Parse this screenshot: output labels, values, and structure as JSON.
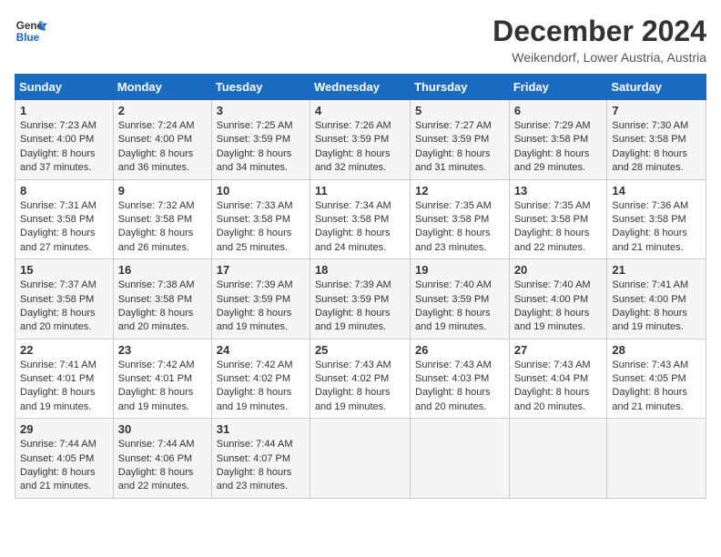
{
  "header": {
    "logo_line1": "General",
    "logo_line2": "Blue",
    "month_title": "December 2024",
    "location": "Weikendorf, Lower Austria, Austria"
  },
  "weekdays": [
    "Sunday",
    "Monday",
    "Tuesday",
    "Wednesday",
    "Thursday",
    "Friday",
    "Saturday"
  ],
  "weeks": [
    [
      {
        "day": "1",
        "sunrise": "7:23 AM",
        "sunset": "4:00 PM",
        "daylight": "8 hours and 37 minutes."
      },
      {
        "day": "2",
        "sunrise": "7:24 AM",
        "sunset": "4:00 PM",
        "daylight": "8 hours and 36 minutes."
      },
      {
        "day": "3",
        "sunrise": "7:25 AM",
        "sunset": "3:59 PM",
        "daylight": "8 hours and 34 minutes."
      },
      {
        "day": "4",
        "sunrise": "7:26 AM",
        "sunset": "3:59 PM",
        "daylight": "8 hours and 32 minutes."
      },
      {
        "day": "5",
        "sunrise": "7:27 AM",
        "sunset": "3:59 PM",
        "daylight": "8 hours and 31 minutes."
      },
      {
        "day": "6",
        "sunrise": "7:29 AM",
        "sunset": "3:58 PM",
        "daylight": "8 hours and 29 minutes."
      },
      {
        "day": "7",
        "sunrise": "7:30 AM",
        "sunset": "3:58 PM",
        "daylight": "8 hours and 28 minutes."
      }
    ],
    [
      {
        "day": "8",
        "sunrise": "7:31 AM",
        "sunset": "3:58 PM",
        "daylight": "8 hours and 27 minutes."
      },
      {
        "day": "9",
        "sunrise": "7:32 AM",
        "sunset": "3:58 PM",
        "daylight": "8 hours and 26 minutes."
      },
      {
        "day": "10",
        "sunrise": "7:33 AM",
        "sunset": "3:58 PM",
        "daylight": "8 hours and 25 minutes."
      },
      {
        "day": "11",
        "sunrise": "7:34 AM",
        "sunset": "3:58 PM",
        "daylight": "8 hours and 24 minutes."
      },
      {
        "day": "12",
        "sunrise": "7:35 AM",
        "sunset": "3:58 PM",
        "daylight": "8 hours and 23 minutes."
      },
      {
        "day": "13",
        "sunrise": "7:35 AM",
        "sunset": "3:58 PM",
        "daylight": "8 hours and 22 minutes."
      },
      {
        "day": "14",
        "sunrise": "7:36 AM",
        "sunset": "3:58 PM",
        "daylight": "8 hours and 21 minutes."
      }
    ],
    [
      {
        "day": "15",
        "sunrise": "7:37 AM",
        "sunset": "3:58 PM",
        "daylight": "8 hours and 20 minutes."
      },
      {
        "day": "16",
        "sunrise": "7:38 AM",
        "sunset": "3:58 PM",
        "daylight": "8 hours and 20 minutes."
      },
      {
        "day": "17",
        "sunrise": "7:39 AM",
        "sunset": "3:59 PM",
        "daylight": "8 hours and 19 minutes."
      },
      {
        "day": "18",
        "sunrise": "7:39 AM",
        "sunset": "3:59 PM",
        "daylight": "8 hours and 19 minutes."
      },
      {
        "day": "19",
        "sunrise": "7:40 AM",
        "sunset": "3:59 PM",
        "daylight": "8 hours and 19 minutes."
      },
      {
        "day": "20",
        "sunrise": "7:40 AM",
        "sunset": "4:00 PM",
        "daylight": "8 hours and 19 minutes."
      },
      {
        "day": "21",
        "sunrise": "7:41 AM",
        "sunset": "4:00 PM",
        "daylight": "8 hours and 19 minutes."
      }
    ],
    [
      {
        "day": "22",
        "sunrise": "7:41 AM",
        "sunset": "4:01 PM",
        "daylight": "8 hours and 19 minutes."
      },
      {
        "day": "23",
        "sunrise": "7:42 AM",
        "sunset": "4:01 PM",
        "daylight": "8 hours and 19 minutes."
      },
      {
        "day": "24",
        "sunrise": "7:42 AM",
        "sunset": "4:02 PM",
        "daylight": "8 hours and 19 minutes."
      },
      {
        "day": "25",
        "sunrise": "7:43 AM",
        "sunset": "4:02 PM",
        "daylight": "8 hours and 19 minutes."
      },
      {
        "day": "26",
        "sunrise": "7:43 AM",
        "sunset": "4:03 PM",
        "daylight": "8 hours and 20 minutes."
      },
      {
        "day": "27",
        "sunrise": "7:43 AM",
        "sunset": "4:04 PM",
        "daylight": "8 hours and 20 minutes."
      },
      {
        "day": "28",
        "sunrise": "7:43 AM",
        "sunset": "4:05 PM",
        "daylight": "8 hours and 21 minutes."
      }
    ],
    [
      {
        "day": "29",
        "sunrise": "7:44 AM",
        "sunset": "4:05 PM",
        "daylight": "8 hours and 21 minutes."
      },
      {
        "day": "30",
        "sunrise": "7:44 AM",
        "sunset": "4:06 PM",
        "daylight": "8 hours and 22 minutes."
      },
      {
        "day": "31",
        "sunrise": "7:44 AM",
        "sunset": "4:07 PM",
        "daylight": "8 hours and 23 minutes."
      },
      null,
      null,
      null,
      null
    ]
  ]
}
